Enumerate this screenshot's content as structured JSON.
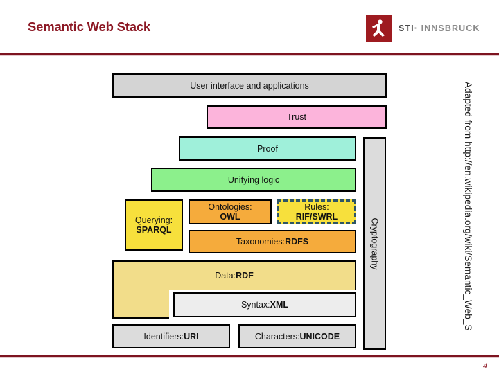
{
  "slide": {
    "title": "Semantic Web Stack",
    "page_number": "4",
    "attribution": "Adapted from http://en.wikipedia.org/wiki/Semantic_Web_S",
    "accent_color": "#7d1420",
    "title_color": "#8c1824"
  },
  "logo": {
    "mark_color": "#9e1b20",
    "icon": "sti-person-icon",
    "text_primary": "STI",
    "separator": "·",
    "text_secondary": "INNSBRUCK"
  },
  "chart_data": {
    "type": "diagram",
    "title": "Semantic Web Stack",
    "layers": [
      {
        "id": "user-interface",
        "label": "User interface and applications",
        "bold": "",
        "color": "#d4d4d4"
      },
      {
        "id": "trust",
        "label": "Trust",
        "bold": "",
        "color": "#fcb4db"
      },
      {
        "id": "proof",
        "label": "Proof",
        "bold": "",
        "color": "#9ff0da"
      },
      {
        "id": "unifying-logic",
        "label": "Unifying logic",
        "bold": "",
        "color": "#8cf08c"
      },
      {
        "id": "querying-sparql",
        "label": "Querying:",
        "bold": "SPARQL",
        "color": "#f7e03c"
      },
      {
        "id": "ontologies-owl",
        "label": "Ontologies:",
        "bold": "OWL",
        "color": "#f5ab3c"
      },
      {
        "id": "rules-rif-swrl",
        "label": "Rules:",
        "bold": "RIF/SWRL",
        "color": "#f7e03c",
        "border": "dashed #2d5566"
      },
      {
        "id": "taxonomies-rdfs",
        "label": "Taxonomies: ",
        "bold": "RDFS",
        "color": "#f5ab3c"
      },
      {
        "id": "data-rdf",
        "label": "Data: ",
        "bold": "RDF",
        "color": "#f2dd8a"
      },
      {
        "id": "syntax-xml",
        "label": "Syntax: ",
        "bold": "XML",
        "color": "#ededed"
      },
      {
        "id": "identifiers-uri",
        "label": "Identifiers: ",
        "bold": "URI",
        "color": "#dcdcdc"
      },
      {
        "id": "characters-unicode",
        "label": "Characters: ",
        "bold": "UNICODE",
        "color": "#dcdcdc"
      },
      {
        "id": "cryptography",
        "label": "Cryptography",
        "bold": "",
        "color": "#dcdcdc",
        "orientation": "vertical"
      }
    ]
  }
}
